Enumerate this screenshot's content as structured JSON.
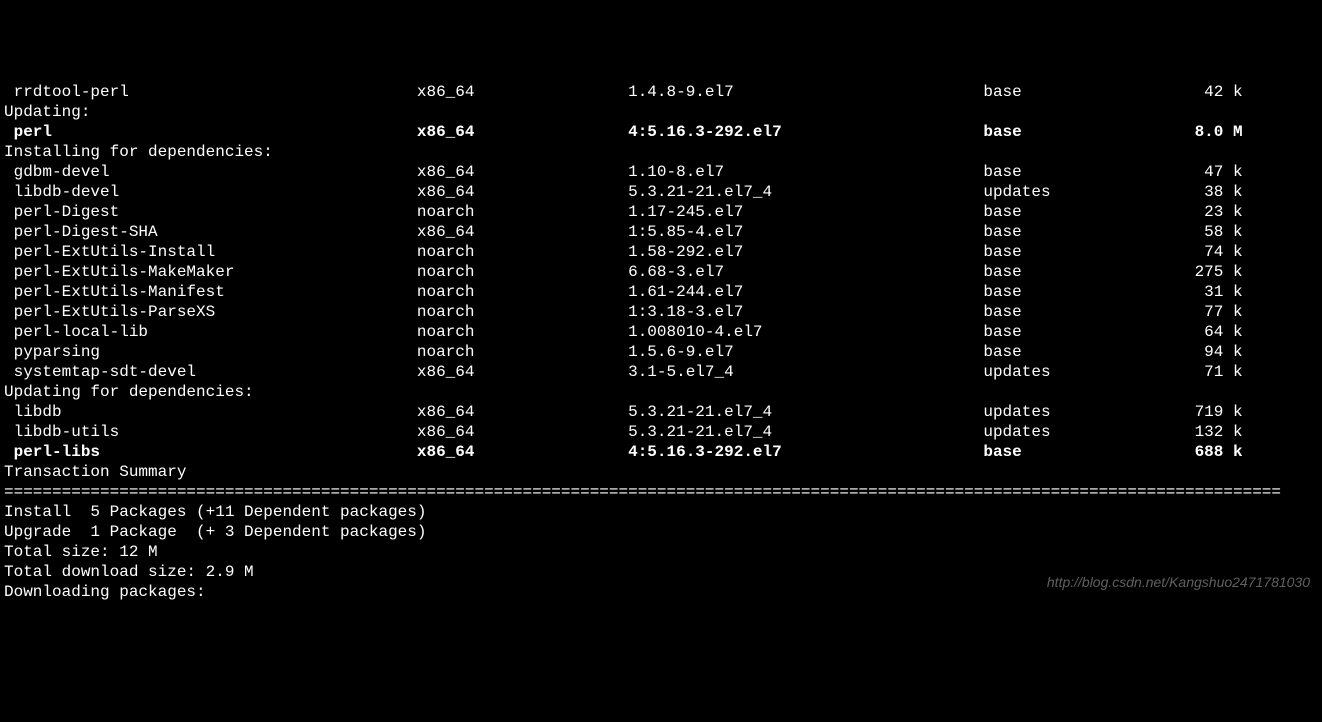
{
  "top_rows": [
    {
      "name": " rrdtool-perl",
      "arch": "x86_64",
      "ver": "1.4.8-9.el7",
      "repo": "base",
      "size": "42 k",
      "bold": false
    }
  ],
  "updating_label": "Updating:",
  "updating_rows": [
    {
      "name": " perl",
      "arch": "x86_64",
      "ver": "4:5.16.3-292.el7",
      "repo": "base",
      "size": "8.0 M",
      "bold": true
    }
  ],
  "installing_dep_label": "Installing for dependencies:",
  "installing_dep_rows": [
    {
      "name": " gdbm-devel",
      "arch": "x86_64",
      "ver": "1.10-8.el7",
      "repo": "base",
      "size": "47 k"
    },
    {
      "name": " libdb-devel",
      "arch": "x86_64",
      "ver": "5.3.21-21.el7_4",
      "repo": "updates",
      "size": "38 k"
    },
    {
      "name": " perl-Digest",
      "arch": "noarch",
      "ver": "1.17-245.el7",
      "repo": "base",
      "size": "23 k"
    },
    {
      "name": " perl-Digest-SHA",
      "arch": "x86_64",
      "ver": "1:5.85-4.el7",
      "repo": "base",
      "size": "58 k"
    },
    {
      "name": " perl-ExtUtils-Install",
      "arch": "noarch",
      "ver": "1.58-292.el7",
      "repo": "base",
      "size": "74 k"
    },
    {
      "name": " perl-ExtUtils-MakeMaker",
      "arch": "noarch",
      "ver": "6.68-3.el7",
      "repo": "base",
      "size": "275 k"
    },
    {
      "name": " perl-ExtUtils-Manifest",
      "arch": "noarch",
      "ver": "1.61-244.el7",
      "repo": "base",
      "size": "31 k"
    },
    {
      "name": " perl-ExtUtils-ParseXS",
      "arch": "noarch",
      "ver": "1:3.18-3.el7",
      "repo": "base",
      "size": "77 k"
    },
    {
      "name": " perl-local-lib",
      "arch": "noarch",
      "ver": "1.008010-4.el7",
      "repo": "base",
      "size": "64 k"
    },
    {
      "name": " pyparsing",
      "arch": "noarch",
      "ver": "1.5.6-9.el7",
      "repo": "base",
      "size": "94 k"
    },
    {
      "name": " systemtap-sdt-devel",
      "arch": "x86_64",
      "ver": "3.1-5.el7_4",
      "repo": "updates",
      "size": "71 k"
    }
  ],
  "updating_dep_label": "Updating for dependencies:",
  "updating_dep_rows": [
    {
      "name": " libdb",
      "arch": "x86_64",
      "ver": "5.3.21-21.el7_4",
      "repo": "updates",
      "size": "719 k"
    },
    {
      "name": " libdb-utils",
      "arch": "x86_64",
      "ver": "5.3.21-21.el7_4",
      "repo": "updates",
      "size": "132 k"
    },
    {
      "name": " perl-libs",
      "arch": "x86_64",
      "ver": "4:5.16.3-292.el7",
      "repo": "base",
      "size": "688 k",
      "bold": true
    }
  ],
  "summary_title": "Transaction Summary",
  "separator": "=====================================================================================================================================",
  "install_line": "Install  5 Packages (+11 Dependent packages)",
  "upgrade_line": "Upgrade  1 Package  (+ 3 Dependent packages)",
  "total_size": "Total size: 12 M",
  "total_dl": "Total download size: 2.9 M",
  "downloading": "Downloading packages:",
  "watermark": "http://blog.csdn.net/Kangshuo2471781030"
}
